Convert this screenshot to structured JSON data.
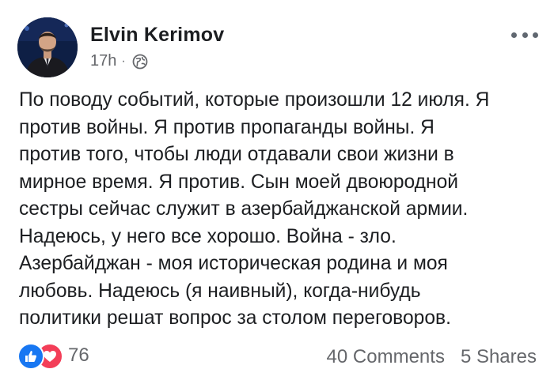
{
  "post": {
    "author_name": "Elvin Kerimov",
    "timestamp": "17h",
    "separator": "·",
    "privacy_icon": "globe-icon",
    "more_icon": "more-options-icon",
    "text_lines": [
      "По поводу событий, которые произошли 12 июля. Я",
      "против войны. Я против пропаганды войны. Я",
      "против того, чтобы люди отдавали свои жизни в",
      "мирное время. Я против. Сын моей двоюродной",
      "сестры сейчас служит в азербайджанской армии.",
      "Надеюсь, у него все хорошо. Война - зло.",
      "Азербайджан - моя историческая родина и моя",
      "любовь. Надеюсь (я наивный), когда-нибудь",
      "политики решат вопрос за столом переговоров."
    ]
  },
  "footer": {
    "reaction_icons": [
      "like-icon",
      "love-icon"
    ],
    "reaction_count": "76",
    "comments": "40 Comments",
    "shares": "5 Shares"
  },
  "colors": {
    "like_blue": "#1877f2",
    "love_red": "#f33e58",
    "meta_gray": "#65676b",
    "text": "#1c1e21"
  }
}
